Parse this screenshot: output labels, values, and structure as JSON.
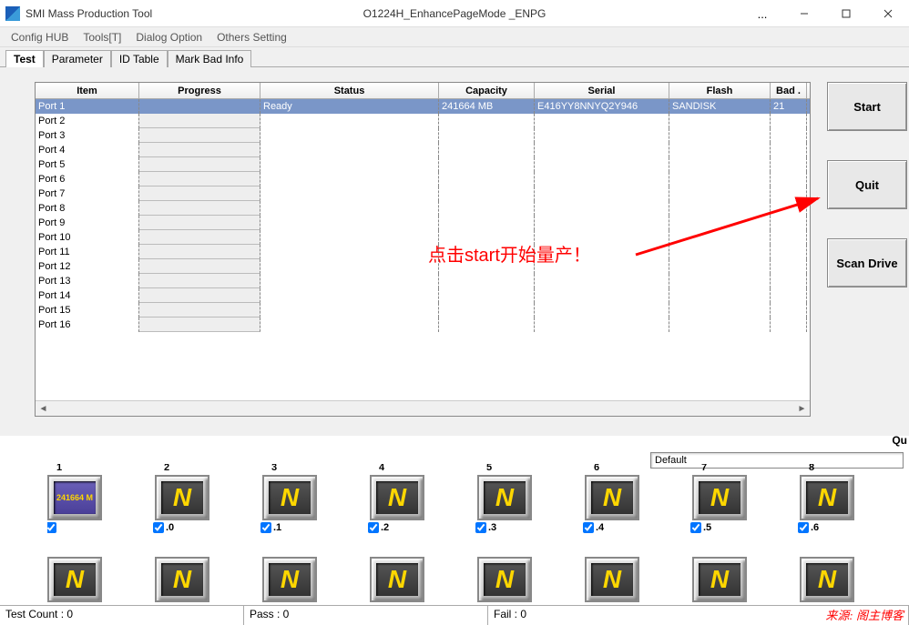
{
  "window": {
    "title": "SMI Mass Production Tool",
    "subtitle": "O1224H_EnhancePageMode    _ENPG",
    "ellipsis": "..."
  },
  "menu": [
    "Config HUB",
    "Tools[T]",
    "Dialog Option",
    "Others Setting"
  ],
  "tabs": [
    "Test",
    "Parameter",
    "ID Table",
    "Mark Bad Info"
  ],
  "columns": [
    "Item",
    "Progress",
    "Status",
    "Capacity",
    "Serial",
    "Flash",
    "Bad ."
  ],
  "rows": [
    {
      "item": "Port 1",
      "progress": "",
      "status": "Ready",
      "capacity": "241664 MB",
      "serial": "E416YY8NNYQ2Y946",
      "flash": "SANDISK",
      "bad": "21",
      "selected": true
    },
    {
      "item": "Port 2"
    },
    {
      "item": "Port 3"
    },
    {
      "item": "Port 4"
    },
    {
      "item": "Port 5"
    },
    {
      "item": "Port 6"
    },
    {
      "item": "Port 7"
    },
    {
      "item": "Port 8"
    },
    {
      "item": "Port 9"
    },
    {
      "item": "Port 10"
    },
    {
      "item": "Port 11"
    },
    {
      "item": "Port 12"
    },
    {
      "item": "Port 13"
    },
    {
      "item": "Port 14"
    },
    {
      "item": "Port 15"
    },
    {
      "item": "Port 16"
    }
  ],
  "buttons": {
    "start": "Start",
    "quit": "Quit",
    "scan": "Scan Drive"
  },
  "qu_label": "Qu",
  "annotation": "点击start开始量产！",
  "default_label": "Default",
  "ports_top": [
    {
      "n": "1",
      "active": true,
      "text": "241664 M",
      "chk": ""
    },
    {
      "n": "2",
      "chk": ".0"
    },
    {
      "n": "3",
      "chk": ".1"
    },
    {
      "n": "4",
      "chk": ".2"
    },
    {
      "n": "5",
      "chk": ".3"
    },
    {
      "n": "6",
      "chk": ".4"
    },
    {
      "n": "7",
      "chk": ".5"
    },
    {
      "n": "8",
      "chk": ".6"
    }
  ],
  "status": {
    "test_count": "Test Count : 0",
    "pass": "Pass : 0",
    "fail": "Fail : 0"
  },
  "watermark": "来源: 阁主博客"
}
